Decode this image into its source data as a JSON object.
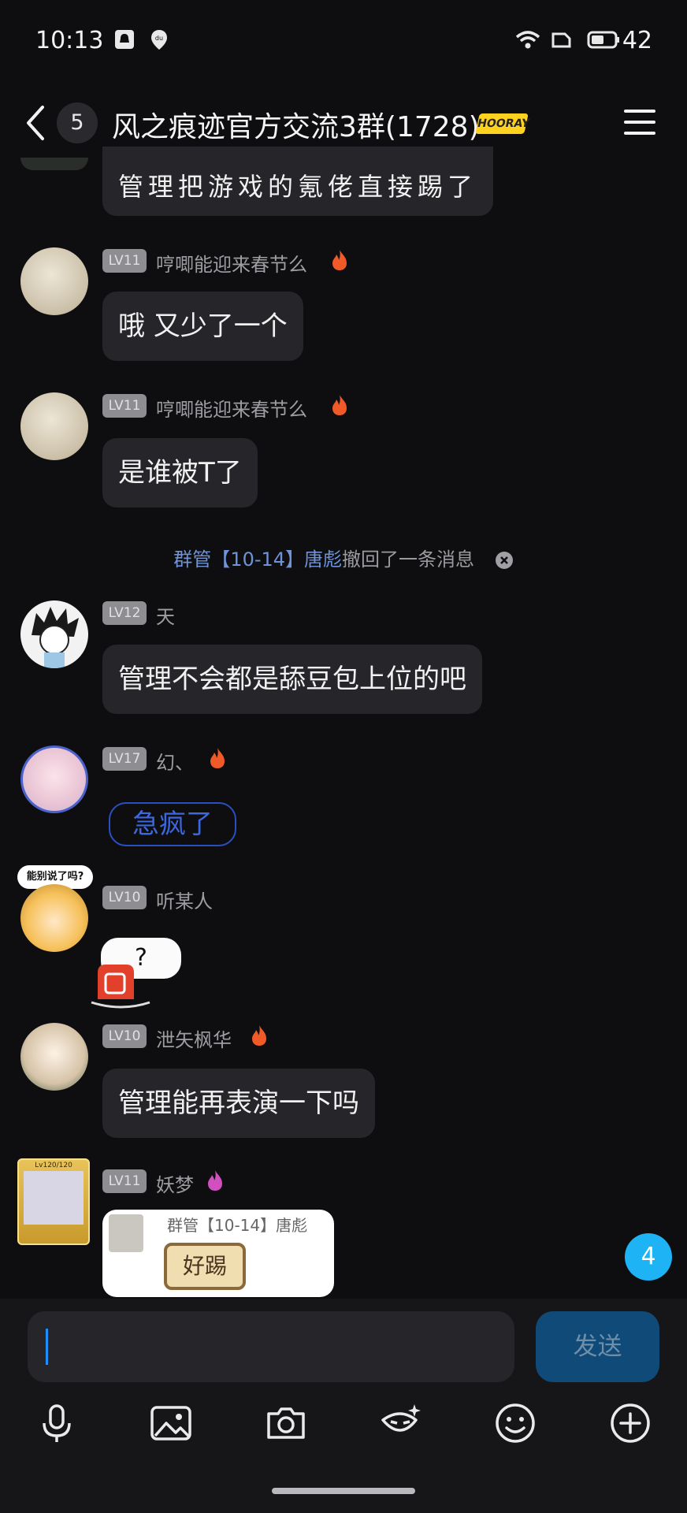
{
  "status_bar": {
    "time": "10:13",
    "battery": "42"
  },
  "header": {
    "unread_count": "5",
    "title": "风之痕迹官方交流3群(1728)",
    "vip_tag": "HOORAY"
  },
  "messages": [
    {
      "text": "管理把游戏的氪佬直接踢了"
    },
    {
      "level": "LV11",
      "nickname": "哼唧能迎来春节么",
      "text": "哦 又少了一个"
    },
    {
      "level": "LV11",
      "nickname": "哼唧能迎来春节么",
      "text": "是谁被T了"
    },
    {
      "level": "LV12",
      "nickname": "天",
      "text": "管理不会都是舔豆包上位的吧"
    },
    {
      "level": "LV17",
      "nickname": "幻、",
      "text": "急疯了"
    },
    {
      "level": "LV10",
      "nickname": "听某人",
      "text": "?",
      "avatar_caption": "能别说了吗?"
    },
    {
      "level": "LV10",
      "nickname": "泄矢枫华",
      "text": "管理能再表演一下吗"
    },
    {
      "level": "LV11",
      "nickname": "妖梦",
      "image_caption": "群管【10-14】唐彪",
      "image_text": "好踢",
      "avatar_badge": "Lv120/120"
    }
  ],
  "system_message": {
    "link_text": "群管【10-14】唐彪",
    "text": "撤回了一条消息"
  },
  "input": {
    "send_label": "发送"
  },
  "float_badge": "4",
  "colors": {
    "accent": "#1eb3f5",
    "bubble": "#26262a",
    "fire": "#f05a28"
  }
}
